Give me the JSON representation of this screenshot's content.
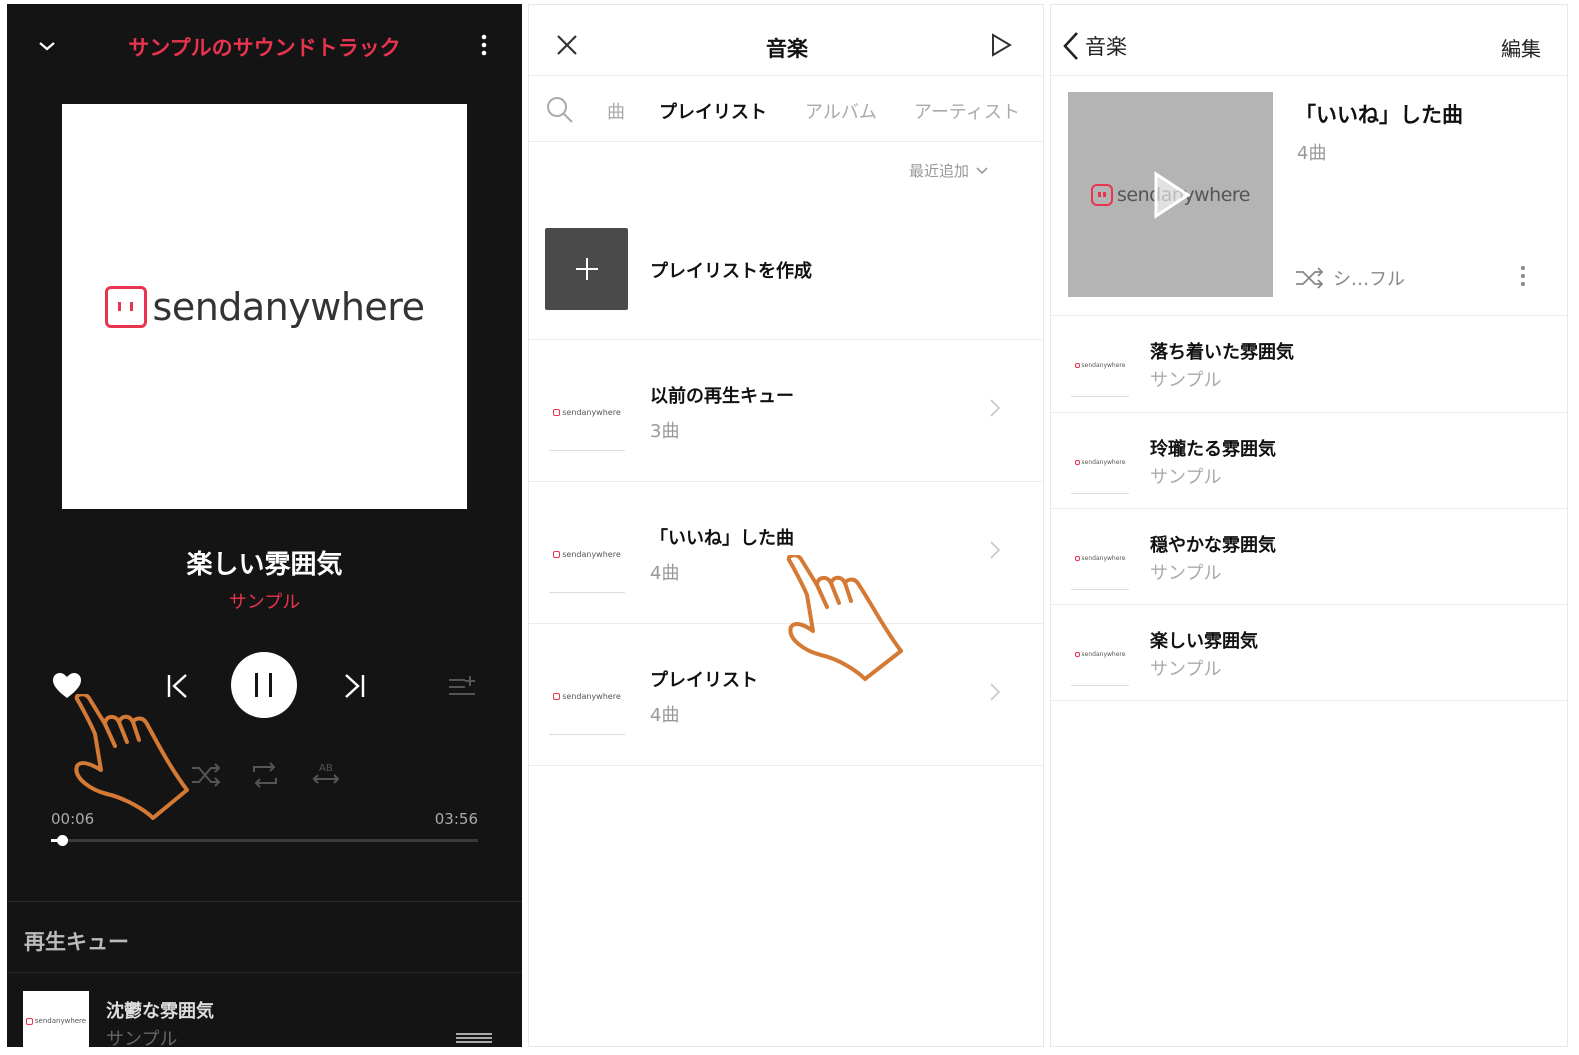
{
  "colors": {
    "accent": "#e8344e",
    "hand": "#d47a35",
    "dark_bg": "#141414"
  },
  "player": {
    "title": "サンプルのサウンドトラック",
    "artwork_brand": "sendanywhere",
    "track_title": "楽しい雰囲気",
    "artist": "サンプル",
    "elapsed": "00:06",
    "duration": "03:56",
    "progress": 0.025,
    "queue_header": "再生キュー",
    "queue": [
      {
        "title": "沈鬱な雰囲気",
        "artist": "サンプル"
      }
    ],
    "icons": [
      "chevron-down-icon",
      "more-icon",
      "heart-icon",
      "previous-icon",
      "pause-icon",
      "next-icon",
      "add-to-queue-icon",
      "shuffle-icon",
      "repeat-icon",
      "ab-repeat-icon",
      "drag-handle-icon"
    ]
  },
  "library": {
    "title": "音楽",
    "tabs": [
      {
        "label": "曲",
        "active": false
      },
      {
        "label": "プレイリスト",
        "active": true
      },
      {
        "label": "アルバム",
        "active": false
      },
      {
        "label": "アーティスト",
        "active": false
      }
    ],
    "sort_label": "最近追加",
    "create_label": "プレイリストを作成",
    "playlists": [
      {
        "name": "以前の再生キュー",
        "count": "3曲"
      },
      {
        "name": "「いいね」した曲",
        "count": "4曲"
      },
      {
        "name": "プレイリスト",
        "count": "4曲"
      }
    ]
  },
  "playlist": {
    "back_label": "音楽",
    "edit_label": "編集",
    "name": "「いいね」した曲",
    "count": "4曲",
    "shuffle_label": "シ…フル",
    "cover_brand": "sendanywhere",
    "songs": [
      {
        "title": "落ち着いた雰囲気",
        "artist": "サンプル"
      },
      {
        "title": "玲瓏たる雰囲気",
        "artist": "サンプル"
      },
      {
        "title": "穏やかな雰囲気",
        "artist": "サンプル"
      },
      {
        "title": "楽しい雰囲気",
        "artist": "サンプル"
      }
    ]
  },
  "thumb_brand": "sendanywhere"
}
